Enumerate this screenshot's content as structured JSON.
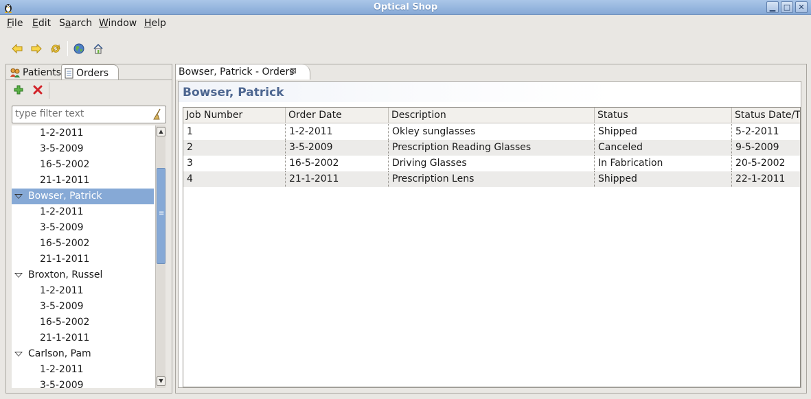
{
  "window": {
    "title": "Optical Shop",
    "controls": [
      "minimize",
      "maximize",
      "close"
    ]
  },
  "menubar": {
    "items": [
      {
        "label": "File",
        "mnemonic": "F"
      },
      {
        "label": "Edit",
        "mnemonic": "E"
      },
      {
        "label": "Search",
        "mnemonic": "a"
      },
      {
        "label": "Window",
        "mnemonic": "W"
      },
      {
        "label": "Help",
        "mnemonic": "H"
      }
    ]
  },
  "toolbar": {
    "buttons": [
      "back-arrow-icon",
      "forward-arrow-icon",
      "sync-icon",
      "globe-icon",
      "home-icon"
    ]
  },
  "left_panel": {
    "tabs": [
      {
        "label": "Patients",
        "icon": "patients-icon"
      },
      {
        "label": "Orders",
        "icon": "document-icon",
        "active": true
      }
    ],
    "actions": [
      "add-icon",
      "delete-icon"
    ],
    "filter": {
      "placeholder": "type filter text",
      "value": ""
    },
    "tree": [
      {
        "type": "child",
        "label": "1-2-2011"
      },
      {
        "type": "child",
        "label": "3-5-2009"
      },
      {
        "type": "child",
        "label": "16-5-2002"
      },
      {
        "type": "child",
        "label": "21-1-2011"
      },
      {
        "type": "parent",
        "label": "Bowser, Patrick",
        "selected": true
      },
      {
        "type": "child",
        "label": "1-2-2011"
      },
      {
        "type": "child",
        "label": "3-5-2009"
      },
      {
        "type": "child",
        "label": "16-5-2002"
      },
      {
        "type": "child",
        "label": "21-1-2011"
      },
      {
        "type": "parent",
        "label": "Broxton, Russel"
      },
      {
        "type": "child",
        "label": "1-2-2011"
      },
      {
        "type": "child",
        "label": "3-5-2009"
      },
      {
        "type": "child",
        "label": "16-5-2002"
      },
      {
        "type": "child",
        "label": "21-1-2011"
      },
      {
        "type": "parent",
        "label": "Carlson, Pam"
      },
      {
        "type": "child",
        "label": "1-2-2011"
      },
      {
        "type": "child",
        "label": "3-5-2009"
      }
    ]
  },
  "editor": {
    "tab_label": "Bowser, Patrick - Orders",
    "form_title": "Bowser, Patrick",
    "table": {
      "columns": [
        "Job Number",
        "Order Date",
        "Description",
        "Status",
        "Status Date/Ti"
      ],
      "rows": [
        [
          "1",
          "1-2-2011",
          "Okley sunglasses",
          "Shipped",
          "5-2-2011"
        ],
        [
          "2",
          "3-5-2009",
          "Prescription Reading Glasses",
          "Canceled",
          "9-5-2009"
        ],
        [
          "3",
          "16-5-2002",
          "Driving Glasses",
          "In Fabrication",
          "20-5-2002"
        ],
        [
          "4",
          "21-1-2011",
          "Prescription Lens",
          "Shipped",
          "22-1-2011"
        ]
      ]
    }
  }
}
